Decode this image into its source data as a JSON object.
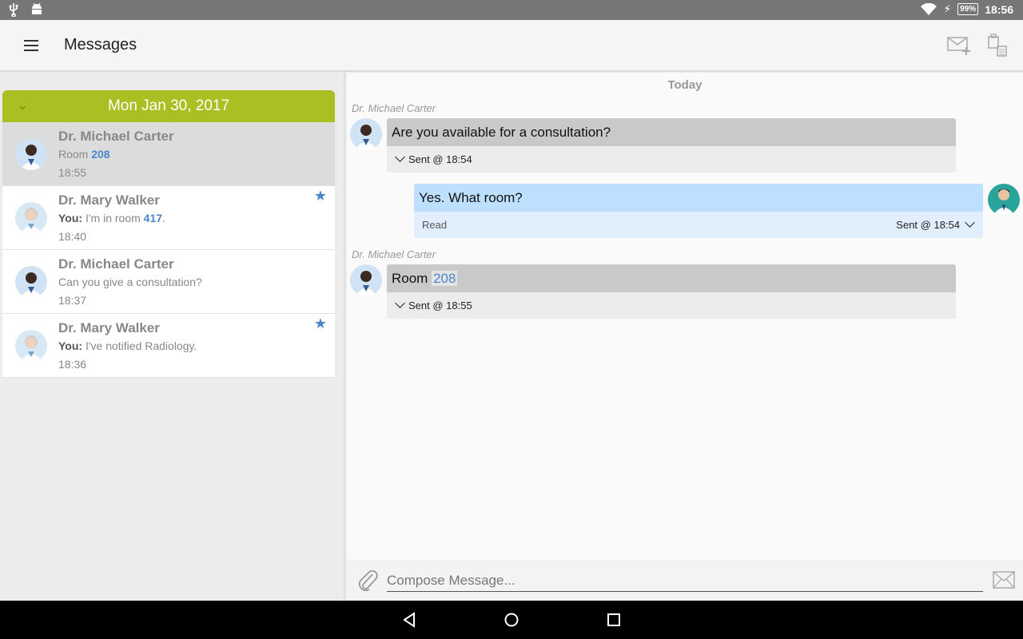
{
  "statusbar": {
    "time": "18:56",
    "battery": "99%"
  },
  "appbar": {
    "title": "Messages"
  },
  "conversations": {
    "date": "Mon Jan 30, 2017",
    "items": [
      {
        "name": "Dr. Michael Carter",
        "preview_prefix": "Room ",
        "preview_number": "208",
        "time": "18:55"
      },
      {
        "name": "Dr. Mary Walker",
        "you": "You:",
        "preview_text": " I'm in room ",
        "preview_number": "417",
        "preview_suffix": ".",
        "time": "18:40",
        "starred": true
      },
      {
        "name": "Dr. Michael Carter",
        "preview_text": "Can you give a consultation?",
        "time": "18:37"
      },
      {
        "name": "Dr. Mary Walker",
        "you": "You:",
        "preview_text": " I've notified Radiology.",
        "time": "18:36",
        "starred": true
      }
    ]
  },
  "thread": {
    "day_label": "Today",
    "messages": [
      {
        "sender": "Dr. Michael Carter",
        "text": "Are you available for a consultation?",
        "sent": "Sent @ 18:54"
      },
      {
        "text": "Yes. What room?",
        "status": "Read",
        "sent": "Sent @ 18:54"
      },
      {
        "sender": "Dr. Michael Carter",
        "text_prefix": "Room ",
        "text_number": "208",
        "sent": "Sent @ 18:55"
      }
    ]
  },
  "compose": {
    "placeholder": "Compose Message..."
  },
  "colors": {
    "accent_green": "#a9bf22",
    "link_blue": "#4a86c8",
    "outgoing_bubble": "#bde0ff"
  }
}
